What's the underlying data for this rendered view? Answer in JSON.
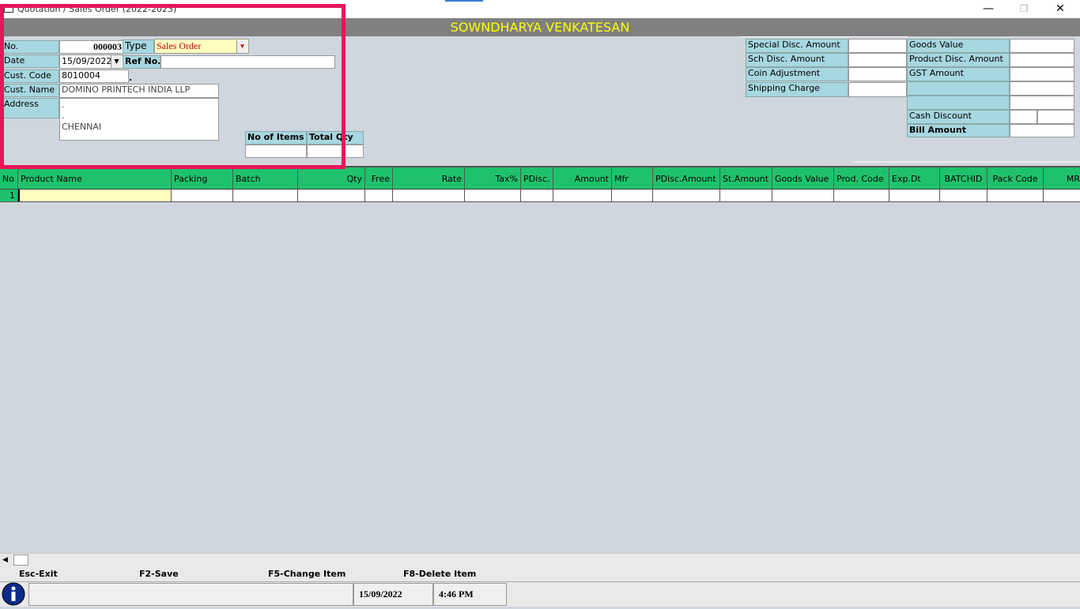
{
  "window": {
    "title": "Quotation / Sales Order (2022-2023)",
    "minimize": "—",
    "restore": "❐",
    "close": "✕"
  },
  "header": {
    "company_name": "SOWNDHARYA VENKATESAN"
  },
  "form": {
    "no_label": "No.",
    "no_value": "000003",
    "type_label": "Type",
    "type_value": "Sales Order",
    "date_label": "Date",
    "date_value": "15/09/2022",
    "refno_label": "Ref No.",
    "refno_value": "",
    "cust_code_label": "Cust. Code",
    "cust_code_value": "8010004",
    "cust_name_label": "Cust. Name",
    "cust_name_value": "DOMINO PRINTECH INDIA LLP",
    "address_label": "Address",
    "address_lines": [
      ".",
      ".",
      "CHENNAI"
    ],
    "no_of_items_label": "No of Items",
    "total_qty_label": "Total Qty"
  },
  "summary_left": {
    "special_disc_label": "Special Disc. Amount",
    "sch_disc_label": "Sch Disc. Amount",
    "coin_adj_label": "Coin Adjustment",
    "shipping_label": "Shipping Charge"
  },
  "summary_right": {
    "goods_value_label": "Goods Value",
    "product_disc_label": "Product Disc. Amount",
    "gst_label": "GST Amount",
    "cash_discount_label": "Cash Discount",
    "bill_amount_label": "Bill Amount"
  },
  "grid": {
    "columns": [
      "No",
      "Product Name",
      "Packing",
      "Batch",
      "Qty",
      "Free",
      "Rate",
      "Tax%",
      "PDisc.",
      "Amount",
      "Mfr",
      "PDisc.Amount",
      "St.Amount",
      "Goods Value",
      "Prod. Code",
      "Exp.Dt",
      "BATCHID",
      "Pack Code",
      "MR"
    ],
    "rows": [
      {
        "no": "1"
      }
    ]
  },
  "shortcuts": {
    "esc": "Esc-Exit",
    "f2": "F2-Save",
    "f5": "F5-Change Item",
    "f8": "F8-Delete Item"
  },
  "status": {
    "date": "15/09/2022",
    "time": "4:46 PM"
  },
  "colors": {
    "header_band": "#808080",
    "header_text": "#ffff00",
    "label_bg": "#a7d7e0",
    "grid_header": "#1fc26c",
    "highlight": "#e5165a",
    "type_bg": "#ffffc0"
  },
  "icons": {
    "info": "info-icon",
    "window": "window-icon"
  }
}
